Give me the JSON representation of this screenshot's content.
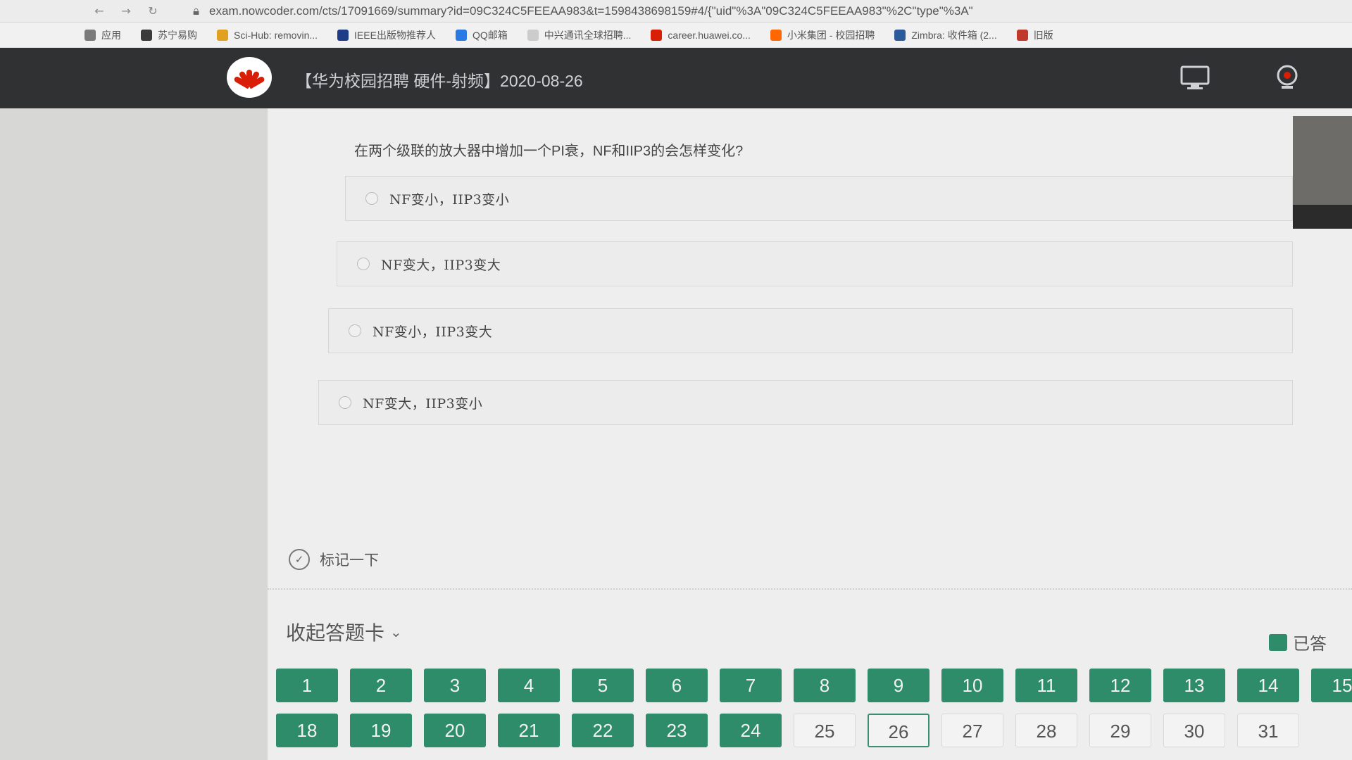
{
  "browser": {
    "url": "exam.nowcoder.com/cts/17091669/summary?id=09C324C5FEEAA983&t=1598438698159#4/{\"uid\"%3A\"09C324C5FEEAA983\"%2C\"type\"%3A\"",
    "bookmarks": [
      {
        "label": "应用",
        "color": "#7a7a7a"
      },
      {
        "label": "苏宁易购",
        "color": "#3a3a3a"
      },
      {
        "label": "Sci-Hub: removin...",
        "color": "#e0a020"
      },
      {
        "label": "IEEE出版物推荐人",
        "color": "#1f3c88"
      },
      {
        "label": "QQ邮箱",
        "color": "#2a7ae4"
      },
      {
        "label": "中兴通讯全球招聘...",
        "color": "#cccccc"
      },
      {
        "label": "career.huawei.co...",
        "color": "#d81e06"
      },
      {
        "label": "小米集团 - 校园招聘",
        "color": "#ff6700"
      },
      {
        "label": "Zimbra: 收件箱 (2...",
        "color": "#2d5a9b"
      },
      {
        "label": "旧版",
        "color": "#c0392b"
      }
    ]
  },
  "header": {
    "title": "【华为校园招聘 硬件-射频】2020-08-26"
  },
  "question": {
    "text": "在两个级联的放大器中增加一个PI衰，NF和IIP3的会怎样变化?",
    "options": [
      "NF变小，IIP3变小",
      "NF变大，IIP3变大",
      "NF变小，IIP3变大",
      "NF变大，IIP3变小"
    ]
  },
  "mark": {
    "label": "标记一下"
  },
  "answer_card": {
    "toggle_label": "收起答题卡",
    "legend_answered": "已答",
    "row1": [
      "1",
      "2",
      "3",
      "4",
      "5",
      "6",
      "7",
      "8",
      "9",
      "10",
      "11",
      "12",
      "13",
      "14",
      "15"
    ],
    "row2": [
      "18",
      "19",
      "20",
      "21",
      "22",
      "23",
      "24",
      "25",
      "26",
      "27",
      "28",
      "29",
      "30",
      "31"
    ],
    "row2_answered_count": 7,
    "current": "26"
  }
}
